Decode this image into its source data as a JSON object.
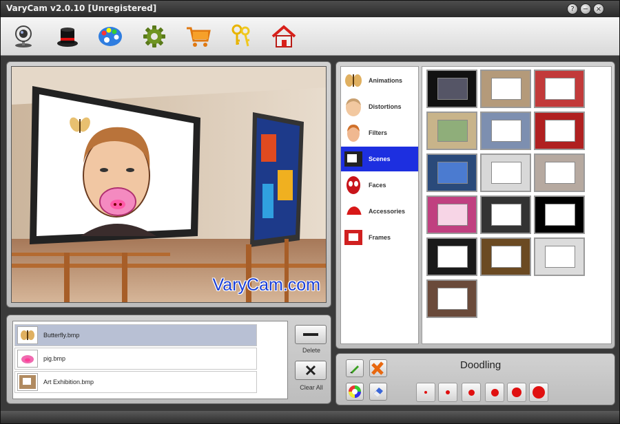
{
  "window": {
    "title": "VaryCam v2.0.10 [Unregistered]",
    "controls": {
      "help": "?",
      "minimize": "−",
      "close": "×"
    }
  },
  "toolbar": {
    "buttons": [
      {
        "name": "webcam",
        "icon": "webcam-icon"
      },
      {
        "name": "effects",
        "icon": "magic-hat-icon"
      },
      {
        "name": "palette",
        "icon": "palette-icon"
      },
      {
        "name": "settings",
        "icon": "gear-icon"
      },
      {
        "name": "shop",
        "icon": "cart-icon"
      },
      {
        "name": "register",
        "icon": "keys-icon"
      },
      {
        "name": "home",
        "icon": "home-icon"
      }
    ]
  },
  "preview": {
    "watermark": "VaryCam.com"
  },
  "layers": {
    "items": [
      {
        "label": "Butterfly.bmp",
        "icon": "butterfly-icon",
        "selected": true
      },
      {
        "label": "pig.bmp",
        "icon": "pig-icon",
        "selected": false
      },
      {
        "label": "Art Exhibition.bmp",
        "icon": "frame-icon",
        "selected": false
      }
    ],
    "delete_label": "Delete",
    "clear_all_label": "Clear All"
  },
  "categories": [
    {
      "label": "Animations",
      "icon": "butterfly-icon",
      "active": false
    },
    {
      "label": "Distortions",
      "icon": "face-icon",
      "active": false
    },
    {
      "label": "Filters",
      "icon": "face-filter-icon",
      "active": false
    },
    {
      "label": "Scenes",
      "icon": "scene-icon",
      "active": true
    },
    {
      "label": "Faces",
      "icon": "mask-icon",
      "active": false
    },
    {
      "label": "Accessories",
      "icon": "hat-icon",
      "active": false
    },
    {
      "label": "Frames",
      "icon": "frame-icon",
      "active": false
    }
  ],
  "scenes": [
    {
      "bg": "#111111",
      "inner": "#555566"
    },
    {
      "bg": "#b49a7a",
      "inner": "#ffffff"
    },
    {
      "bg": "#c23a3a",
      "inner": "#ffffff"
    },
    {
      "bg": "#c8b48a",
      "inner": "#8fae7a"
    },
    {
      "bg": "#7d8fb0",
      "inner": "#ffffff"
    },
    {
      "bg": "#b02020",
      "inner": "#ffffff"
    },
    {
      "bg": "#2a4a7a",
      "inner": "#4b7bd0"
    },
    {
      "bg": "#d8d8d8",
      "inner": "#ffffff"
    },
    {
      "bg": "#b6a9a0",
      "inner": "#ffffff"
    },
    {
      "bg": "#c04080",
      "inner": "#f7d5e6"
    },
    {
      "bg": "#333333",
      "inner": "#ffffff"
    },
    {
      "bg": "#000000",
      "inner": "#ffffff"
    },
    {
      "bg": "#1a1a1a",
      "inner": "#ffffff"
    },
    {
      "bg": "#6b4a22",
      "inner": "#ffffff"
    },
    {
      "bg": "#dcdcdc",
      "inner": "#ffffff"
    },
    {
      "bg": "#6a4a3a",
      "inner": "#ffffff"
    }
  ],
  "doodling": {
    "title": "Doodling",
    "tools": [
      {
        "name": "pencil",
        "icon": "pencil-icon"
      },
      {
        "name": "clear",
        "icon": "brush-cross-icon"
      },
      {
        "name": "color",
        "icon": "color-wheel-icon"
      },
      {
        "name": "eraser",
        "icon": "eraser-icon"
      }
    ],
    "brush_color": "#e01010"
  }
}
